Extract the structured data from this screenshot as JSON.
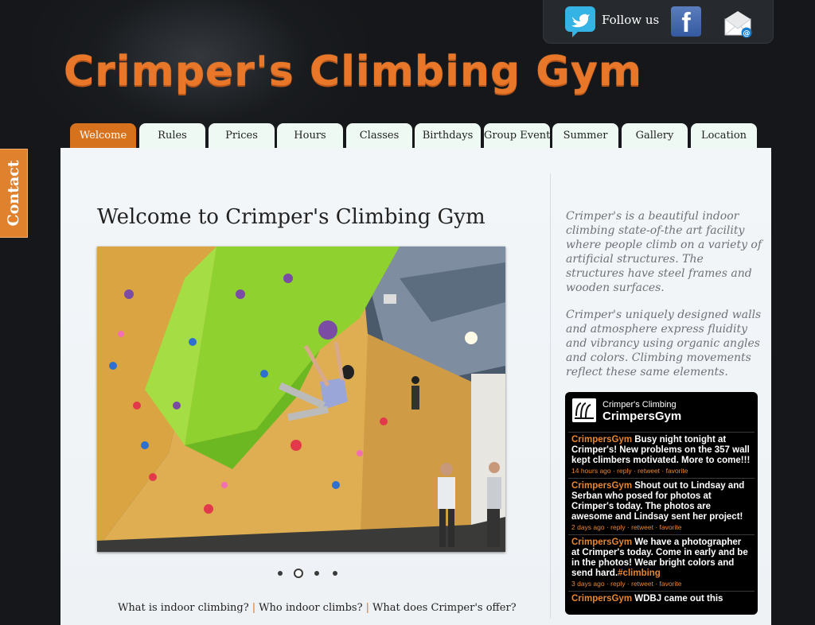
{
  "header": {
    "logo_text": "Crimper's Climbing Gym",
    "follow_text": "Follow us",
    "social_icons": [
      "twitter-bird-icon",
      "facebook-icon",
      "email-envelope-icon"
    ],
    "facebook_letter": "f"
  },
  "contact_tab": {
    "label": "Contact"
  },
  "nav": {
    "tabs": [
      {
        "label": "Welcome",
        "active": true
      },
      {
        "label": "Rules"
      },
      {
        "label": "Prices"
      },
      {
        "label": "Hours"
      },
      {
        "label": "Classes"
      },
      {
        "label": "Birthdays"
      },
      {
        "label": "Group Events"
      },
      {
        "label": "Summer"
      },
      {
        "label": "Gallery"
      },
      {
        "label": "Location"
      }
    ]
  },
  "main": {
    "title": "Welcome to Crimper's Climbing Gym",
    "slideshow": {
      "slide_count": 4,
      "active_index": 1
    },
    "bottom_links": [
      "What is indoor climbing?",
      "Who indoor climbs?",
      "What does Crimper's offer?"
    ]
  },
  "sidebar": {
    "about_p1": "Crimper's is a beautiful indoor climbing state-of-the art facility where people climb on a variety of artificial structures. The structures have steel frames and wooden surfaces.",
    "about_p2": "Crimper's uniquely designed walls and atmosphere express fluidity and vibrancy using organic angles and colors. Climbing movements reflect these same elements."
  },
  "twitter_widget": {
    "name": "Crimper's Climbing",
    "handle": "CrimpersGym",
    "tweets": [
      {
        "user": "CrimpersGym",
        "text": "Busy night tonight at Crimper's! New problems on the 357 wall kept climbers motivated. More to come!!!",
        "hashtag": "",
        "meta": "14 hours ago · reply · retweet · favorite"
      },
      {
        "user": "CrimpersGym",
        "text": "Shout out to Lindsay and Serban who posed for photos at Crimper's today. The photos are awesome and Lindsay sent her project!",
        "hashtag": "",
        "meta": "2 days ago · reply · retweet · favorite"
      },
      {
        "user": "CrimpersGym",
        "text": "We have a photographer at Crimper's today. Come in early and be in the photos! Wear bright colors and send hard.",
        "hashtag": "#climbing",
        "meta": "3 days ago · reply · retweet · favorite"
      },
      {
        "user": "CrimpersGym",
        "text": "WDBJ came out this",
        "hashtag": "",
        "meta": ""
      }
    ]
  },
  "colors": {
    "accent": "#d6721e",
    "logo": "#e8772a",
    "background": "#15171a",
    "tab_bg": "#eef9f3"
  }
}
